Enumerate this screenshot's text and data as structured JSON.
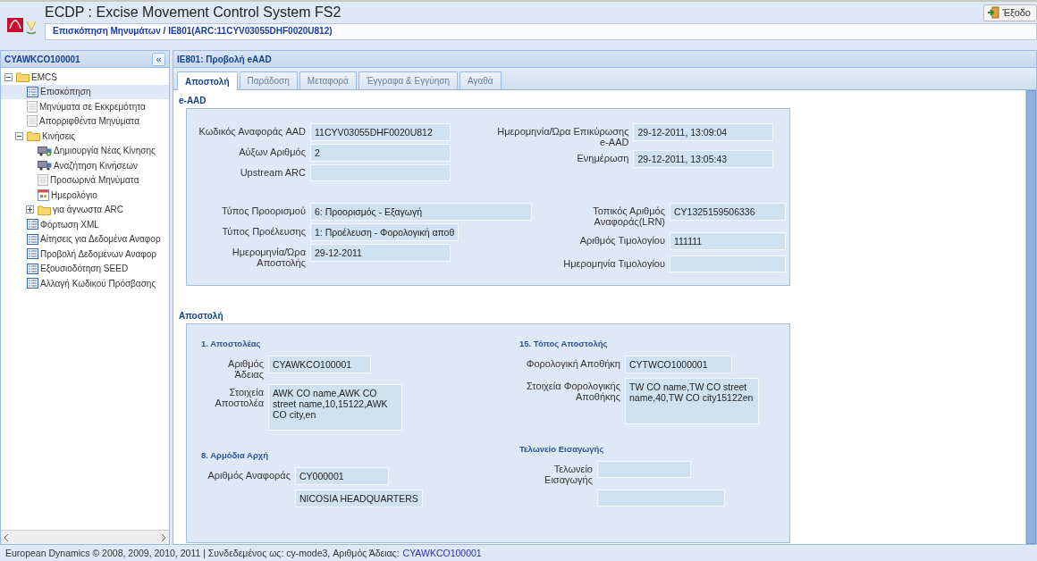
{
  "header": {
    "title": "ECDP : Excise Movement Control System FS2",
    "breadcrumb": "Επισκόπηση Μηνυμάτων / IE801(ARC:11CYV03055DHF0020U812)",
    "exit_button": "Έξοδο"
  },
  "sidebar": {
    "title": "CYAWKCO100001",
    "collapse_button": "«",
    "tree": [
      {
        "label": "EMCS",
        "kind": "folder",
        "selected": false,
        "expanded": true,
        "children": [
          {
            "label": "Επισκόπηση",
            "kind": "list",
            "selected": true
          },
          {
            "label": "Μηνύματα σε Εκκρεμότητα",
            "kind": "doc",
            "selected": false
          },
          {
            "label": "Απορριφθέντα Μηνύματα",
            "kind": "doc",
            "selected": false
          },
          {
            "label": "Κινήσεις",
            "kind": "folder",
            "selected": false,
            "expanded": true,
            "children": [
              {
                "label": "Δημιουργία Νέας Κίνησης",
                "kind": "truck-add",
                "selected": false
              },
              {
                "label": "Αναζήτηση Κινήσεων",
                "kind": "truck",
                "selected": false
              },
              {
                "label": "Προσωρινά Μηνύματα",
                "kind": "doc",
                "selected": false
              },
              {
                "label": "Ημερολόγιο",
                "kind": "calendar",
                "selected": false
              },
              {
                "label": "για άγνωστα ARC",
                "kind": "folder",
                "selected": false,
                "expanded": false
              }
            ]
          },
          {
            "label": "Φόρτωση XML",
            "kind": "list",
            "selected": false
          },
          {
            "label": "Αίτησεις για Δεδομένα Αναφορ",
            "kind": "list",
            "selected": false
          },
          {
            "label": "Προβολή Δεδομένων Αναφορ",
            "kind": "list",
            "selected": false
          },
          {
            "label": "Εξουσιοδότηση SEED",
            "kind": "list",
            "selected": false
          },
          {
            "label": "Αλλαγή Κωδικού Πρόσβασης",
            "kind": "list",
            "selected": false
          }
        ]
      }
    ]
  },
  "main": {
    "title": "IE801: Προβολή eAAD",
    "tabs": [
      {
        "label": "Αποστολή",
        "selected": true
      },
      {
        "label": "Παράδοση",
        "selected": false
      },
      {
        "label": "Μεταφορά",
        "selected": false
      },
      {
        "label": "Έγγραφα & Εγγύηση",
        "selected": false
      },
      {
        "label": "Αγαθά",
        "selected": false
      }
    ],
    "eaad": {
      "title": "e-AAD",
      "groups": [
        [
          [
            {
              "label": "Κωδικός Αναφοράς AAD",
              "value": "11CYV03055DHF0020U812",
              "kind": "text"
            },
            {
              "label": "Αύξων Αριθμός",
              "value": "2",
              "kind": "text"
            },
            {
              "label": "Upstream ARC",
              "kind": "text"
            }
          ],
          [
            {
              "label": "Ημερομηνία/Ώρα Επικύρωσης e-AAD",
              "value": "29-12-2011, 13:09:04",
              "kind": "text"
            },
            {
              "label": "Ενημέρωση",
              "value": "29-12-2011, 13:05:43",
              "kind": "text"
            }
          ]
        ],
        [
          [
            {
              "label": "Τύπος Προορισμού",
              "value": "6: Προορισμός - Εξαγωγή",
              "kind": "wide"
            },
            {
              "label": "Τύπος Προέλευσης",
              "value": "1: Προέλευση - Φορολογική αποθ",
              "kind": "text"
            },
            {
              "label": "Ημερομηνία/Ώρα Αποστολής",
              "value": "29-12-2011",
              "kind": "text"
            }
          ],
          [
            {
              "label": "Τοπικός Αριθμός Αναφοράς(LRN)",
              "value": "CY1325159506336",
              "kind": "text"
            },
            {
              "label": "Αριθμός Τιμολογίου",
              "value": "111111",
              "kind": "text"
            },
            {
              "label": "Ημερομηνία Τιμολογίου",
              "kind": "text"
            }
          ]
        ]
      ]
    },
    "dispatch": {
      "title": "Αποστολή",
      "columns": [
        [
          {
            "title": "1. Αποστολέας",
            "fields": [
              {
                "label": "Αριθμός Άδειας",
                "value": "CYAWKCO100001",
                "kind": "text"
              },
              {
                "label": "Στοιχεία Αποστολέα",
                "value": "AWK CO name,AWK CO street name,10,15122,AWK CO city,en",
                "kind": "multiline"
              }
            ]
          },
          {
            "title": "8. Αρμόδια Αρχή",
            "fields": [
              {
                "label": "Αριθμός Αναφοράς",
                "value": "CY000001",
                "kind": "text"
              },
              {
                "value": "NICOSIA HEADQUARTERS",
                "kind": "text"
              }
            ]
          }
        ],
        [
          {
            "title": "15. Τόπος Αποστολής",
            "fields": [
              {
                "label": "Φορολογική Αποθήκη",
                "value": "CYTWCO1000001",
                "kind": "text"
              },
              {
                "label": "Στοιχεία Φορολογικής Αποθήκης",
                "value": "TW CO name,TW CO street name,40,TW CO city15122en",
                "kind": "multiline"
              }
            ]
          },
          {
            "title": "Τελωνείο Εισαγωγής",
            "fields": [
              {
                "label": "Τελωνείο Εισαγωγής",
                "kind": "text"
              },
              {
                "kind": "wide"
              }
            ]
          }
        ]
      ]
    }
  },
  "footer": {
    "text": "European Dynamics © 2008, 2009, 2010, 2011 | Συνδεδεμένος ως: cy-mode3, Αριθμός Άδειας:",
    "link": "CYAWKCO100001"
  }
}
